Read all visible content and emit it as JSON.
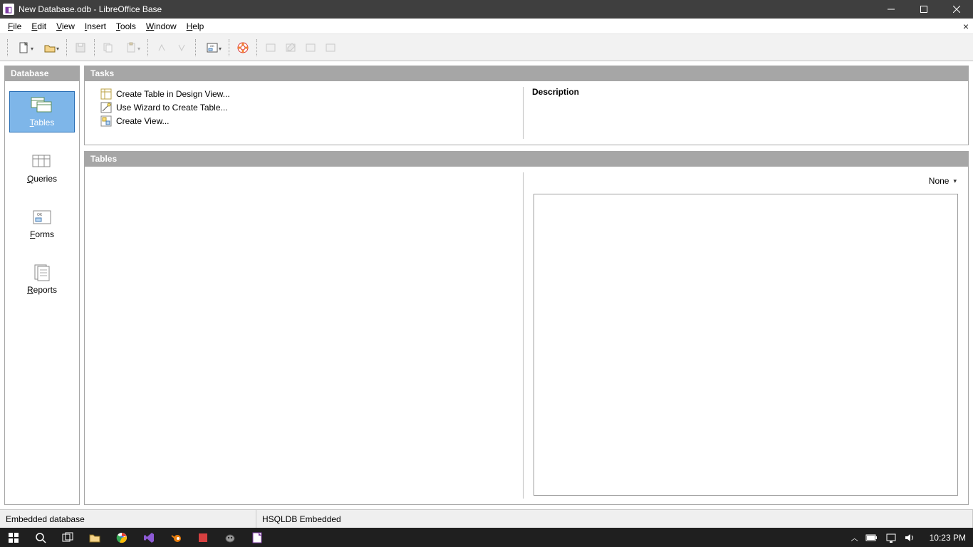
{
  "window": {
    "title": "New Database.odb - LibreOffice Base"
  },
  "menu": {
    "file": "File",
    "edit": "Edit",
    "view": "View",
    "insert": "Insert",
    "tools": "Tools",
    "window": "Window",
    "help": "Help"
  },
  "panels": {
    "database_header": "Database",
    "tasks_header": "Tasks",
    "tables_header": "Tables",
    "description_header": "Description"
  },
  "database_items": {
    "tables": "Tables",
    "queries": "Queries",
    "forms": "Forms",
    "reports": "Reports"
  },
  "tasks": {
    "create_table_design": "Create Table in Design View...",
    "use_wizard": "Use Wizard to Create Table...",
    "create_view": "Create View..."
  },
  "tables_panel": {
    "none_label": "None"
  },
  "statusbar": {
    "embedded": "Embedded database",
    "engine": "HSQLDB Embedded"
  },
  "taskbar": {
    "clock": "10:23 PM"
  }
}
